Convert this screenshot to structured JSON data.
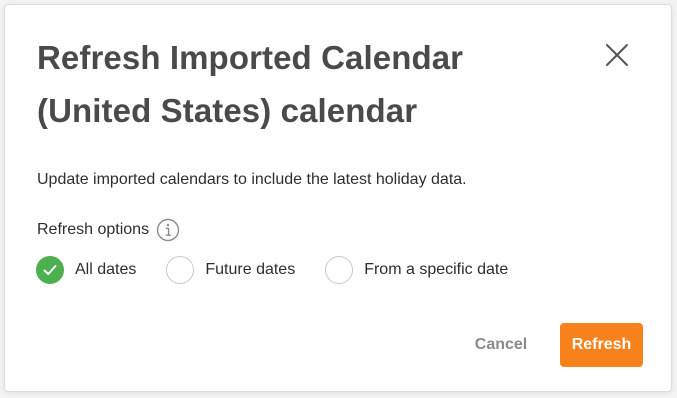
{
  "dialog": {
    "title": "Refresh Imported Calendar (United States) calendar",
    "description": "Update imported calendars to include the latest holiday data.",
    "close_icon": "close-icon"
  },
  "refresh_options": {
    "label": "Refresh options",
    "info_icon": "info-icon",
    "selected": "All dates",
    "options": [
      {
        "label": "All dates",
        "checked": true
      },
      {
        "label": "Future dates",
        "checked": false
      },
      {
        "label": "From a specific date",
        "checked": false
      }
    ]
  },
  "buttons": {
    "cancel_label": "Cancel",
    "refresh_label": "Refresh"
  },
  "colors": {
    "accent": "#f7821b",
    "checked": "#4caf50",
    "title": "#4a4a4a",
    "muted": "#8a8a8a"
  }
}
